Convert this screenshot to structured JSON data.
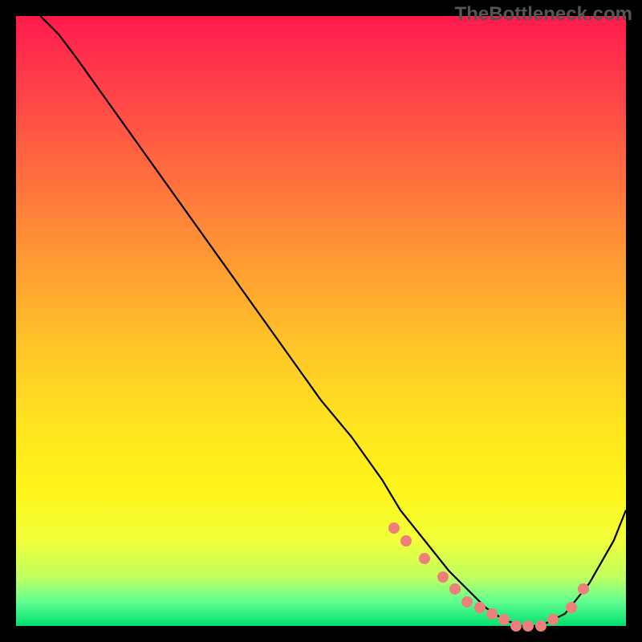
{
  "watermark": "TheBottleneck.com",
  "chart_data": {
    "type": "line",
    "title": "",
    "xlabel": "",
    "ylabel": "",
    "xlim": [
      0,
      100
    ],
    "ylim": [
      0,
      100
    ],
    "grid": false,
    "legend": false,
    "series": [
      {
        "name": "curve",
        "x": [
          4,
          7,
          10,
          15,
          20,
          25,
          30,
          35,
          40,
          45,
          50,
          55,
          60,
          63,
          67,
          71,
          74,
          77,
          80,
          83,
          86,
          90,
          94,
          98,
          100
        ],
        "y": [
          100,
          97,
          93,
          86,
          79,
          72,
          65,
          58,
          51,
          44,
          37,
          31,
          24,
          19,
          14,
          9,
          6,
          3,
          1,
          0,
          0,
          2,
          7,
          14,
          19
        ]
      }
    ],
    "markers": {
      "name": "highlight-dots",
      "x": [
        62,
        64,
        67,
        70,
        72,
        74,
        76,
        78,
        80,
        82,
        84,
        86,
        88,
        91,
        93
      ],
      "y": [
        16,
        14,
        11,
        8,
        6,
        4,
        3,
        2,
        1,
        0,
        0,
        0,
        1,
        3,
        6
      ]
    },
    "background_gradient": {
      "stops": [
        {
          "pos": 0.0,
          "color": "#ff1a4d"
        },
        {
          "pos": 0.25,
          "color": "#ff6a3f"
        },
        {
          "pos": 0.55,
          "color": "#ffc727"
        },
        {
          "pos": 0.78,
          "color": "#fff51a"
        },
        {
          "pos": 0.92,
          "color": "#c0ff60"
        },
        {
          "pos": 1.0,
          "color": "#00e070"
        }
      ]
    }
  }
}
